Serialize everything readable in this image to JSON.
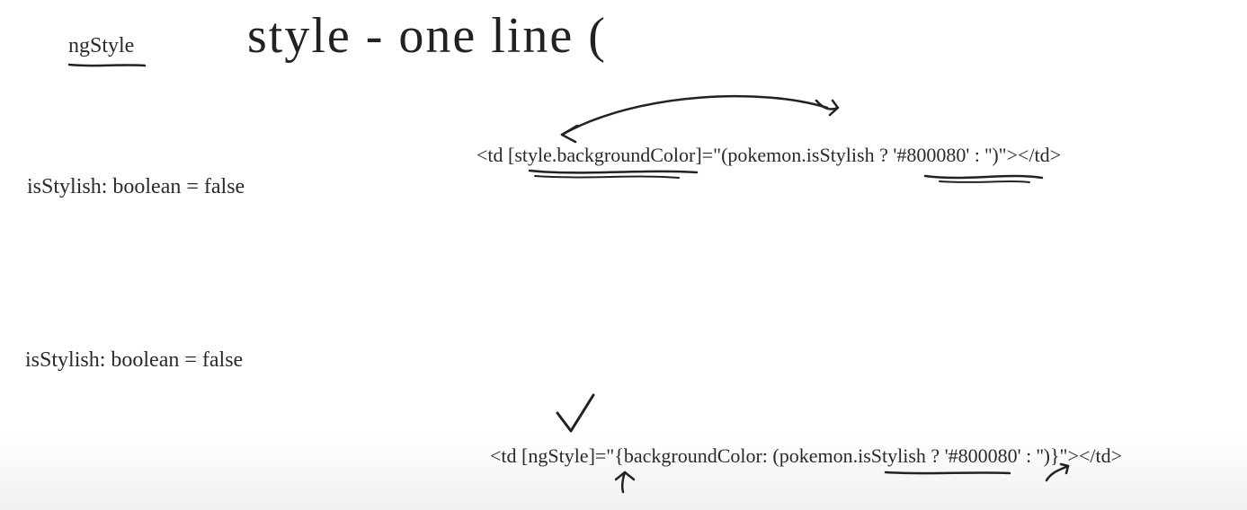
{
  "header": {
    "label": "ngStyle",
    "big_title": "style - one line ("
  },
  "example1": {
    "declaration": "isStylish: boolean = false",
    "code": "<td [style.backgroundColor]=\"(pokemon.isStylish ? '#800080' : '')\"></td>"
  },
  "example2": {
    "declaration": "isStylish: boolean = false",
    "code": "<td [ngStyle]=\"{backgroundColor: (pokemon.isStylish ? '#800080' : '')}\"></td>"
  }
}
